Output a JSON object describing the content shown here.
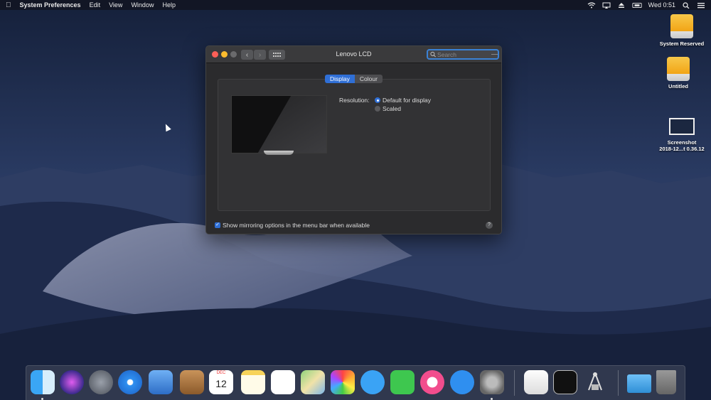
{
  "menubar": {
    "apple": "",
    "app_name": "System Preferences",
    "menus": [
      "Edit",
      "View",
      "Window",
      "Help"
    ],
    "clock": "Wed 0:51"
  },
  "window": {
    "title": "Lenovo LCD",
    "search_placeholder": "Search",
    "tabs": [
      "Display",
      "Colour"
    ],
    "active_tab": "Display",
    "resolution_label": "Resolution:",
    "resolution_options": [
      "Default for display",
      "Scaled"
    ],
    "selected_resolution": "Default for display",
    "mirroring_label": "Show mirroring options in the menu bar when available",
    "mirroring_checked": true,
    "help": "?"
  },
  "desktop_icons": [
    {
      "label": "System Reserved",
      "icon": "hard-drive-icon"
    },
    {
      "label": "Untitled",
      "icon": "hard-drive-icon"
    },
    {
      "label_line1": "Screenshot",
      "label_line2": "2018-12...t 0.36.12",
      "icon": "screenshot-file-icon"
    }
  ],
  "dock": {
    "calendar_month": "DEC",
    "calendar_day": "12",
    "apps": [
      "finder",
      "siri",
      "launchpad",
      "safari",
      "mail",
      "contacts",
      "calendar",
      "notes",
      "reminders",
      "maps",
      "photos",
      "messages",
      "facetime",
      "itunes",
      "app-store",
      "system-preferences",
      "textedit",
      "terminal",
      "digital-color-meter",
      "downloads-folder",
      "trash"
    ]
  },
  "colors": {
    "accent": "#2f6fd6",
    "window_bg": "#2b2b2d",
    "menubar_bg": "#121624"
  }
}
